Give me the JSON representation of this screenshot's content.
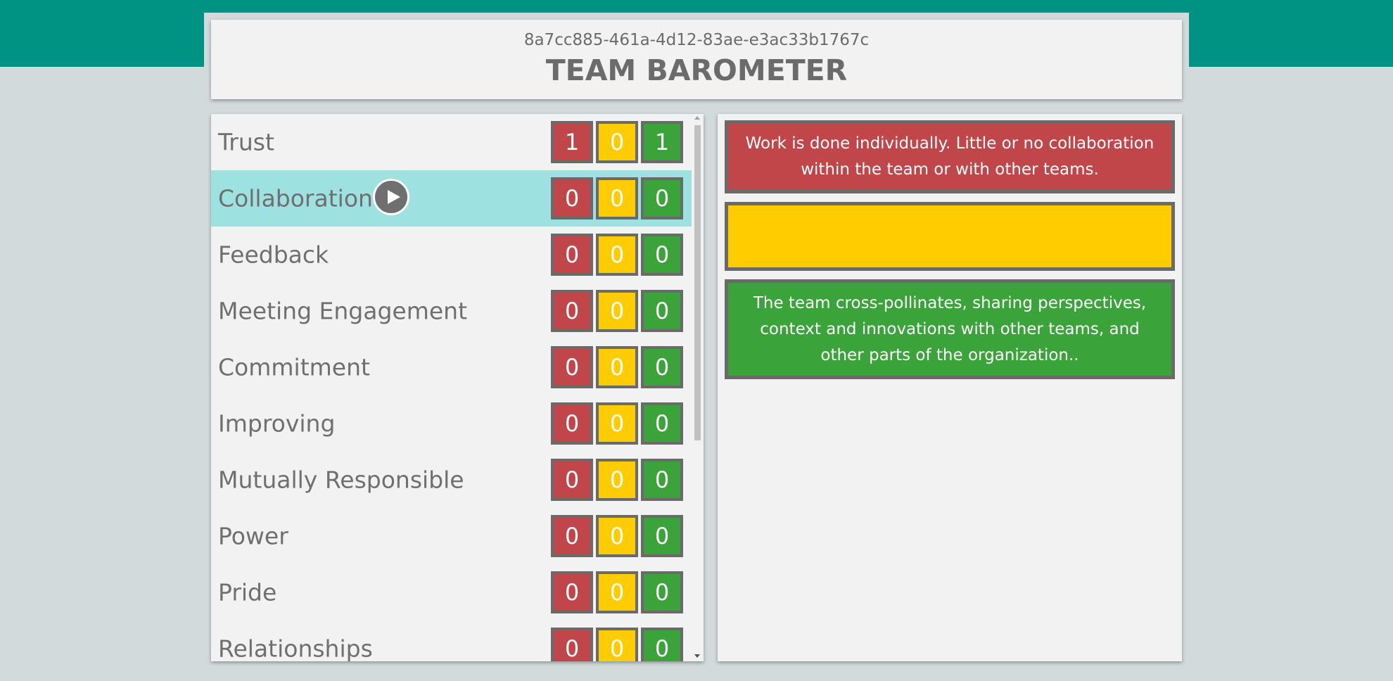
{
  "header": {
    "session_id": "8a7cc885-461a-4d12-83ae-e3ac33b1767c",
    "title": "TEAM BAROMETER"
  },
  "colors": {
    "teal": "#009384",
    "red": "#c0464a",
    "yellow": "#ffcc00",
    "green": "#3aa43a",
    "active_row": "#9de1e0"
  },
  "questions": [
    {
      "label": "Trust",
      "red": "1",
      "yellow": "0",
      "green": "1",
      "active": false
    },
    {
      "label": "Collaboration",
      "red": "0",
      "yellow": "0",
      "green": "0",
      "active": true
    },
    {
      "label": "Feedback",
      "red": "0",
      "yellow": "0",
      "green": "0",
      "active": false
    },
    {
      "label": "Meeting Engagement",
      "red": "0",
      "yellow": "0",
      "green": "0",
      "active": false
    },
    {
      "label": "Commitment",
      "red": "0",
      "yellow": "0",
      "green": "0",
      "active": false
    },
    {
      "label": "Improving",
      "red": "0",
      "yellow": "0",
      "green": "0",
      "active": false
    },
    {
      "label": "Mutually Responsible",
      "red": "0",
      "yellow": "0",
      "green": "0",
      "active": false
    },
    {
      "label": "Power",
      "red": "0",
      "yellow": "0",
      "green": "0",
      "active": false
    },
    {
      "label": "Pride",
      "red": "0",
      "yellow": "0",
      "green": "0",
      "active": false
    },
    {
      "label": "Relationships",
      "red": "0",
      "yellow": "0",
      "green": "0",
      "active": false
    }
  ],
  "play_icon": "play-icon",
  "detail": {
    "red_text": "Work is done individually. Little or no collaboration within the team or with other teams.",
    "yellow_text": "",
    "green_text": "The team cross-pollinates, sharing perspectives, context and innovations with other teams, and other parts of the organization.."
  }
}
